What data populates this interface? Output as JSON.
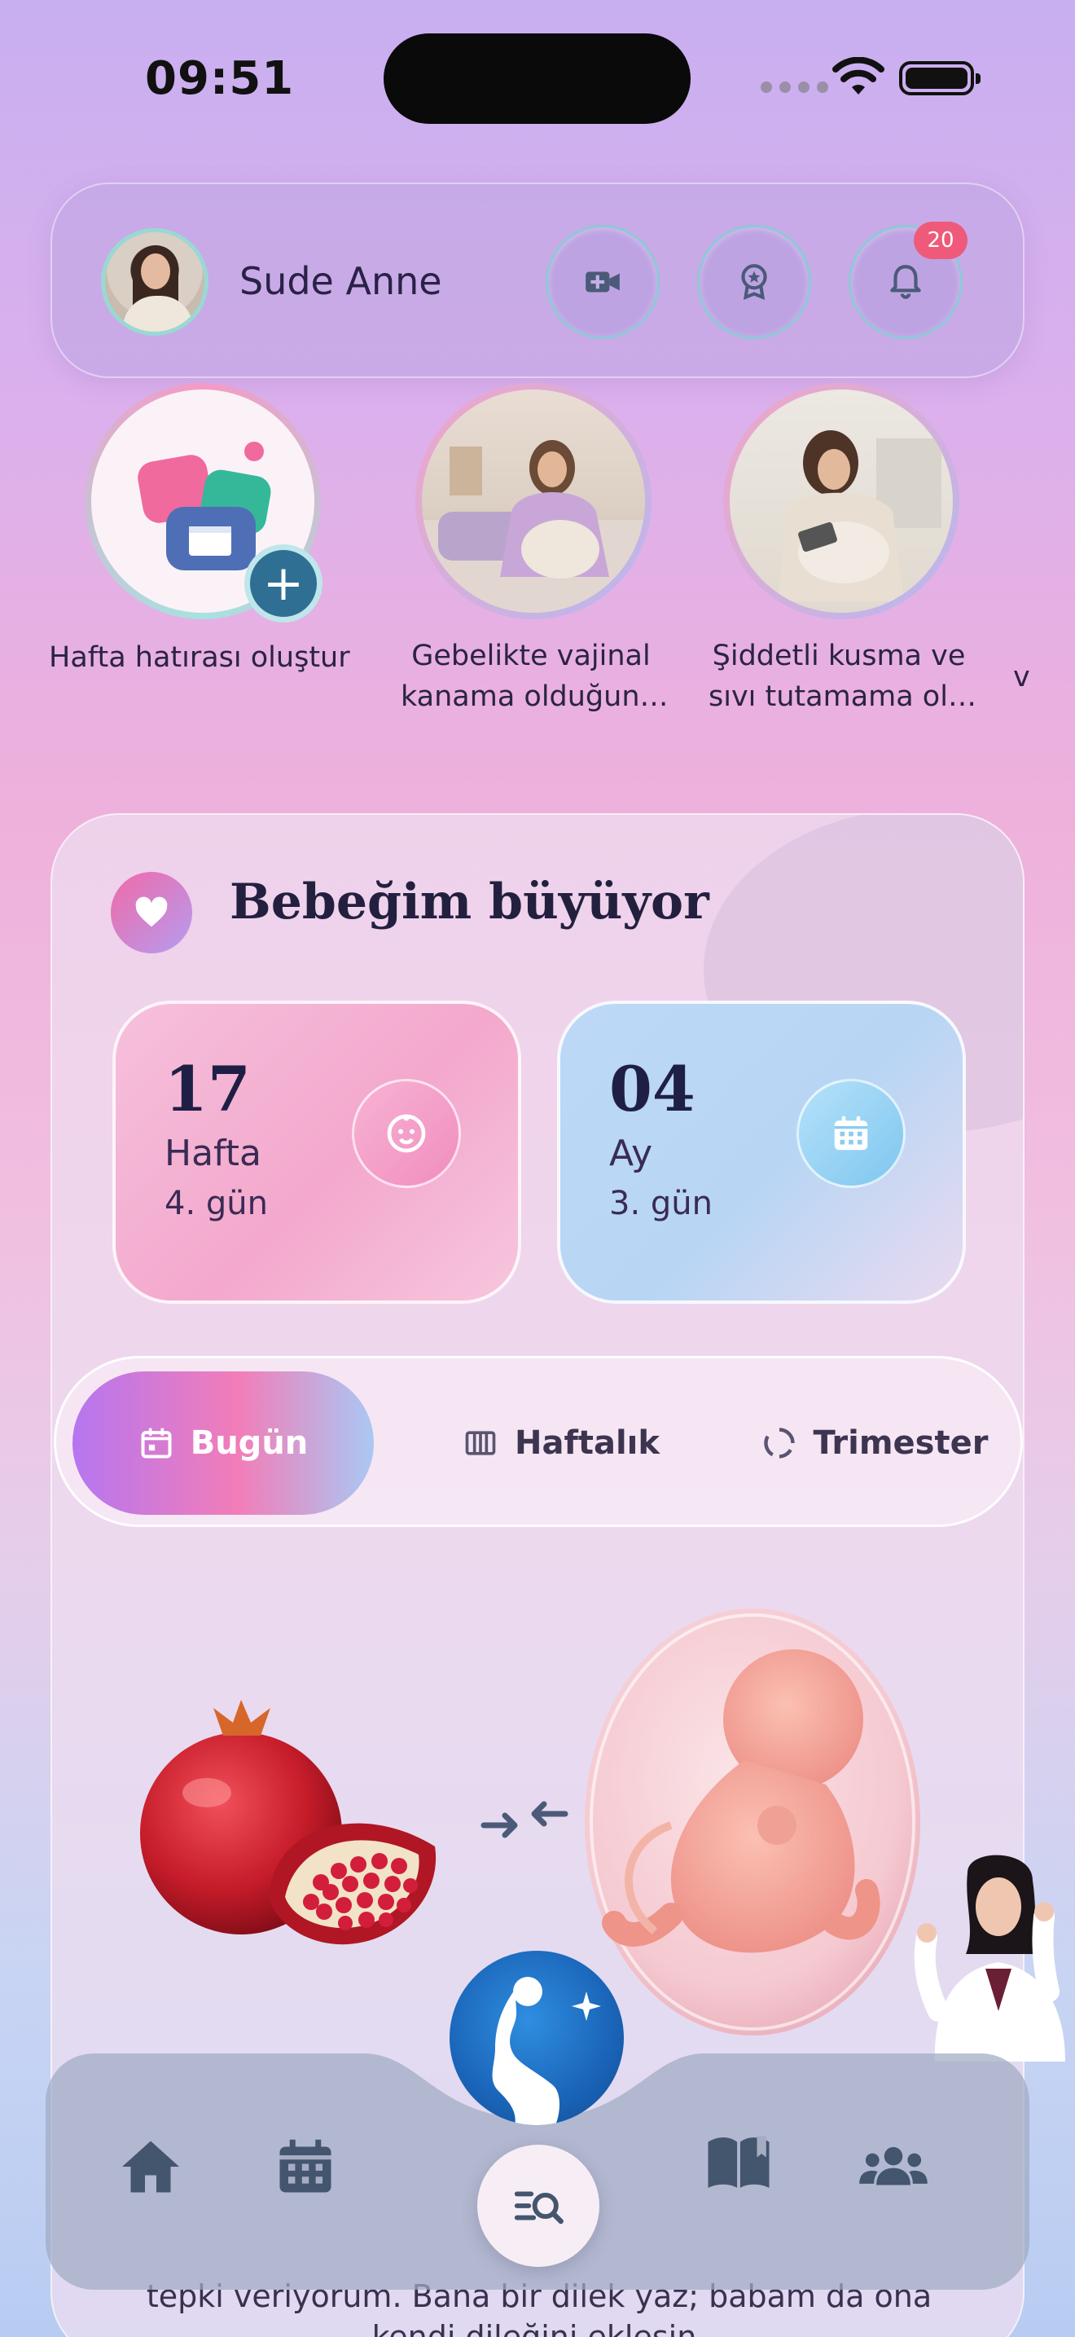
{
  "status_bar": {
    "time": "09:51"
  },
  "header": {
    "user_name": "Sude Anne",
    "notification_count": "20",
    "icons": [
      "avatar",
      "video-camera-icon",
      "award-badge-icon",
      "bell-icon"
    ]
  },
  "stories": [
    {
      "label_line1": "Hafta hatırası oluştur",
      "label_line2": ""
    },
    {
      "label_line1": "Gebelikte vajinal",
      "label_line2": "kanama olduğun…"
    },
    {
      "label_line1": "Şiddetli kusma ve",
      "label_line2": "sıvı tutamama ol…"
    },
    {
      "label_line1": "v",
      "label_line2": ""
    }
  ],
  "main": {
    "title": "Bebeğim büyüyor",
    "week_card": {
      "number": "17",
      "unit": "Hafta",
      "day": "4. gün"
    },
    "month_card": {
      "number": "04",
      "unit": "Ay",
      "day": "3. gün"
    },
    "tabs": [
      {
        "label": "Bugün",
        "active": true
      },
      {
        "label": "Haftalık",
        "active": false
      },
      {
        "label": "Trimester",
        "active": false
      }
    ],
    "comparison": {
      "fruit": "pomegranate",
      "baby": "fetus",
      "icon": "compare-arrows-icon"
    },
    "footer_line1": "tepki veriyorum. Bana bir dilek yaz; babam da ona",
    "footer_line2": "kendi dileğini eklesin."
  },
  "bottom_nav": {
    "items": [
      "home-icon",
      "calendar-icon",
      "search-list-icon",
      "book-icon",
      "community-icon"
    ]
  },
  "colors": {
    "accent_pink": "#f27db8",
    "accent_purple": "#b676f0",
    "badge_red": "#ef5a7a",
    "nav_icon": "#44556e",
    "logo_blue": "#1a64b8"
  }
}
